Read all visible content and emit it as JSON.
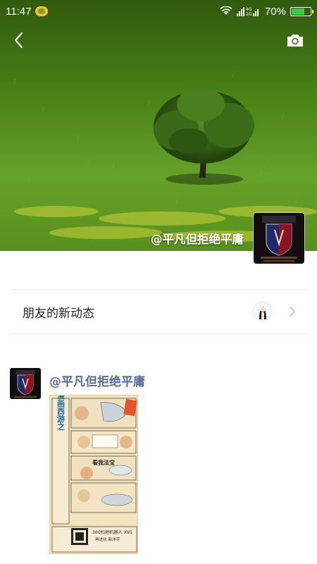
{
  "status_bar": {
    "time": "11:47",
    "network": "4G 2G",
    "battery_percent": "70%",
    "battery_level": 0.7,
    "battery_color": "#3ec84a"
  },
  "header": {
    "back_icon": "chevron-left-icon",
    "camera_icon": "camera-icon"
  },
  "cover": {
    "user_name": "@平凡但拒绝平庸",
    "grass_color": "#5c9a21"
  },
  "friends_update": {
    "label": "朋友的新动态"
  },
  "post": {
    "author": "@平凡但拒绝平庸",
    "author_color": "#576b95",
    "image_texts": {
      "title": "漫画西游之",
      "subtitle": "看我法宝",
      "product": "360扫地机器人 X95",
      "tagline": "再进化 新洋芋"
    }
  }
}
